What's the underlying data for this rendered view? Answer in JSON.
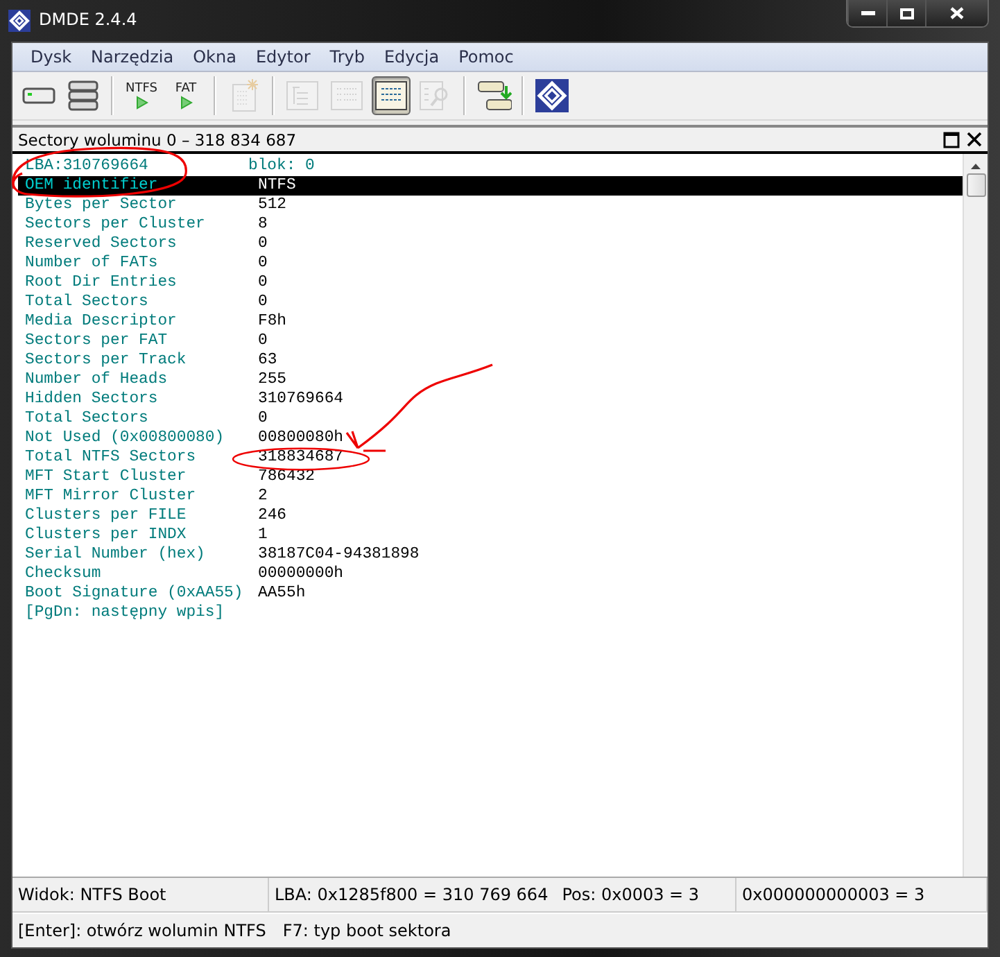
{
  "window": {
    "title": "DMDE 2.4.4"
  },
  "menu": [
    {
      "label": "Dysk"
    },
    {
      "label": "Narzędzia"
    },
    {
      "label": "Okna"
    },
    {
      "label": "Edytor"
    },
    {
      "label": "Tryb"
    },
    {
      "label": "Edycja"
    },
    {
      "label": "Pomoc"
    }
  ],
  "toolbar": [
    {
      "kind": "icon",
      "disabled": false,
      "pressed": false
    },
    {
      "kind": "icon",
      "disabled": false,
      "pressed": false
    },
    {
      "kind": "separator"
    },
    {
      "kind": "run",
      "label": "NTFS",
      "disabled": false,
      "pressed": false
    },
    {
      "kind": "run",
      "label": "FAT",
      "disabled": false,
      "pressed": false
    },
    {
      "kind": "separator"
    },
    {
      "kind": "icon",
      "disabled": true,
      "pressed": false
    },
    {
      "kind": "separator"
    },
    {
      "kind": "icon",
      "disabled": true,
      "pressed": false
    },
    {
      "kind": "icon",
      "disabled": true,
      "pressed": false
    },
    {
      "kind": "icon",
      "disabled": false,
      "pressed": true
    },
    {
      "kind": "icon",
      "disabled": true,
      "pressed": false
    },
    {
      "kind": "separator"
    },
    {
      "kind": "icon",
      "disabled": false,
      "pressed": false
    },
    {
      "kind": "separator"
    },
    {
      "kind": "icon",
      "disabled": false,
      "pressed": false
    }
  ],
  "panel": {
    "title": "Sectory woluminu 0 – 318 834 687"
  },
  "rows": [
    {
      "kind": "header",
      "label": "LBA:310769664",
      "value": "blok: 0"
    },
    {
      "kind": "field",
      "label": "OEM identifier",
      "value": "NTFS",
      "selected": true
    },
    {
      "kind": "field",
      "label": "Bytes per Sector",
      "value": "512",
      "selected": false
    },
    {
      "kind": "field",
      "label": "Sectors per Cluster",
      "value": "8",
      "selected": false
    },
    {
      "kind": "field",
      "label": "Reserved Sectors",
      "value": "0",
      "selected": false
    },
    {
      "kind": "field",
      "label": "Number of FATs",
      "value": "0",
      "selected": false
    },
    {
      "kind": "field",
      "label": "Root Dir Entries",
      "value": "0",
      "selected": false
    },
    {
      "kind": "field",
      "label": "Total Sectors",
      "value": "0",
      "selected": false
    },
    {
      "kind": "field",
      "label": "Media Descriptor",
      "value": "F8h",
      "selected": false
    },
    {
      "kind": "field",
      "label": "Sectors per FAT",
      "value": "0",
      "selected": false
    },
    {
      "kind": "field",
      "label": "Sectors per Track",
      "value": "63",
      "selected": false
    },
    {
      "kind": "field",
      "label": "Number of Heads",
      "value": "255",
      "selected": false
    },
    {
      "kind": "field",
      "label": "Hidden Sectors",
      "value": "310769664",
      "selected": false
    },
    {
      "kind": "field",
      "label": "Total Sectors",
      "value": "0",
      "selected": false
    },
    {
      "kind": "field",
      "label": "Not Used (0x00800080)",
      "value": "00800080h",
      "selected": false
    },
    {
      "kind": "field",
      "label": "Total NTFS Sectors",
      "value": "318834687",
      "selected": false
    },
    {
      "kind": "field",
      "label": "MFT Start Cluster",
      "value": "786432",
      "selected": false
    },
    {
      "kind": "field",
      "label": "MFT Mirror Cluster",
      "value": "2",
      "selected": false
    },
    {
      "kind": "field",
      "label": "Clusters per FILE",
      "value": "246",
      "selected": false
    },
    {
      "kind": "field",
      "label": "Clusters per INDX",
      "value": "1",
      "selected": false
    },
    {
      "kind": "field",
      "label": "Serial Number (hex)",
      "value": "38187C04-94381898",
      "selected": false
    },
    {
      "kind": "field",
      "label": "Checksum",
      "value": "00000000h",
      "selected": false
    },
    {
      "kind": "field",
      "label": "Boot Signature (0xAA55)",
      "value": "AA55h",
      "selected": false
    },
    {
      "kind": "hint",
      "label": "[PgDn: następny wpis]"
    }
  ],
  "status_bar": [
    [
      "Widok: NTFS Boot"
    ],
    [
      "LBA: 0x1285f800 = 310 769 664",
      "Pos: 0x0003 = 3"
    ],
    [
      "0x000000000003 = 3"
    ]
  ],
  "hint_bar": [
    "[Enter]: otwórz wolumin NTFS",
    "F7: typ boot sektora"
  ]
}
